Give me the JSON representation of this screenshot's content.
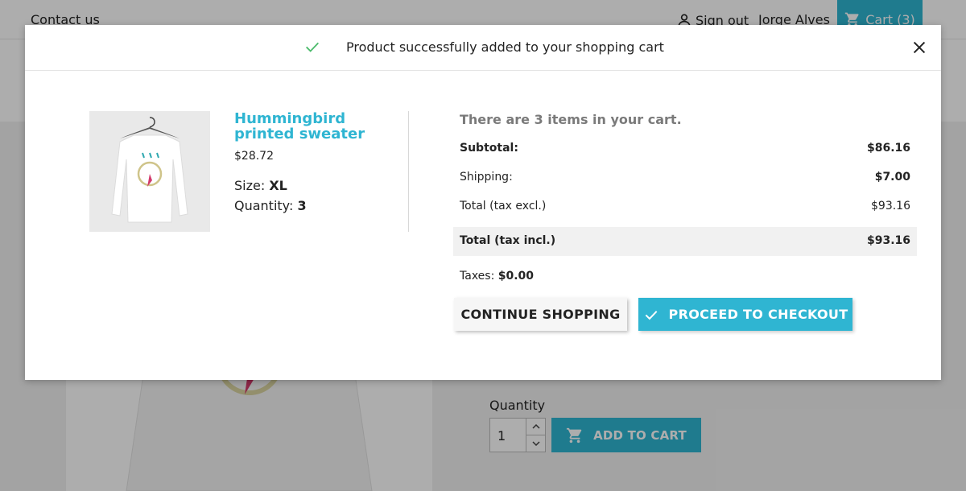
{
  "colors": {
    "accent": "#2fb5d2",
    "success_check": "#4cbb6c",
    "overlay": "rgba(0,0,0,0.32)",
    "muted_heading": "#7a7a7a"
  },
  "background_page": {
    "nav": {
      "contact_label": "Contact us",
      "signout_label": "Sign out",
      "user_name": "Jorge Alves",
      "cart_label": "Cart (3)"
    },
    "product_form": {
      "quantity_label": "Quantity",
      "quantity_value": "1",
      "add_to_cart_label": "ADD TO CART"
    }
  },
  "modal": {
    "title": "Product successfully added to your shopping cart",
    "icons": {
      "success": "check-icon",
      "close": "close-icon"
    },
    "product": {
      "name": "Hummingbird printed sweater",
      "price": "$28.72",
      "size_label": "Size:",
      "size_value": "XL",
      "quantity_label": "Quantity:",
      "quantity_value": "3"
    },
    "cart": {
      "items_text": "There are 3 items in your cart.",
      "subtotal_label": "Subtotal:",
      "subtotal_value": "$86.16",
      "shipping_label": "Shipping:",
      "shipping_value": "$7.00",
      "total_excl_label": "Total (tax excl.)",
      "total_excl_value": "$93.16",
      "total_incl_label": "Total (tax incl.)",
      "total_incl_value": "$93.16",
      "taxes_label": "Taxes:",
      "taxes_value": "$0.00"
    },
    "buttons": {
      "continue_label": "CONTINUE SHOPPING",
      "checkout_label": "PROCEED TO CHECKOUT"
    }
  }
}
